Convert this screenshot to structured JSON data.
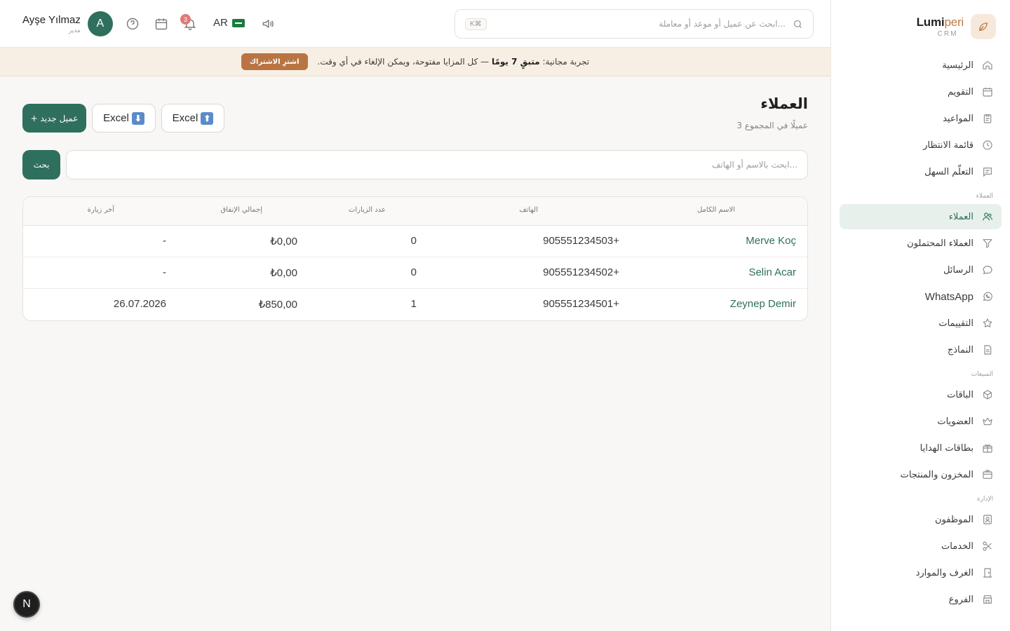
{
  "brand": {
    "name_main": "Lumi",
    "name_accent": "peri",
    "sub": "CRM",
    "accent_color": "#c17a45"
  },
  "theme": {
    "primary": "#2f6f5e",
    "banner_bg": "#f7efe4",
    "subscribe": "#b97443"
  },
  "sidebar": {
    "items_top": [
      {
        "label": "الرئيسية",
        "icon": "home-icon"
      },
      {
        "label": "التقويم",
        "icon": "calendar-icon"
      },
      {
        "label": "المواعيد",
        "icon": "clipboard-icon"
      },
      {
        "label": "قائمة الانتظار",
        "icon": "clock-icon"
      },
      {
        "label": "التعلّم السهل",
        "icon": "chat-icon"
      }
    ],
    "section_customers": "العملاء",
    "items_customers": [
      {
        "label": "العملاء",
        "icon": "users-icon",
        "active": true
      },
      {
        "label": "العملاء المحتملون",
        "icon": "filter-icon"
      },
      {
        "label": "الرسائل",
        "icon": "message-icon"
      },
      {
        "label": "WhatsApp",
        "icon": "whatsapp-icon"
      },
      {
        "label": "التقييمات",
        "icon": "star-icon"
      },
      {
        "label": "النماذج",
        "icon": "document-icon"
      }
    ],
    "section_sales": "المبيعات",
    "items_sales": [
      {
        "label": "الباقات",
        "icon": "box-icon"
      },
      {
        "label": "العضويات",
        "icon": "crown-icon"
      },
      {
        "label": "بطاقات الهدايا",
        "icon": "gift-icon"
      },
      {
        "label": "المخزون والمنتجات",
        "icon": "inventory-icon"
      }
    ],
    "section_admin": "الإدارة",
    "items_admin": [
      {
        "label": "الموظفون",
        "icon": "staff-icon"
      },
      {
        "label": "الخدمات",
        "icon": "scissors-icon"
      },
      {
        "label": "الغرف والموارد",
        "icon": "door-icon"
      },
      {
        "label": "الفروع",
        "icon": "store-icon"
      }
    ]
  },
  "topbar": {
    "search_placeholder": "ابحث عن عميل أو موعد أو معاملة...",
    "shortcut": "K⌘",
    "user_name": "Ayşe Yılmaz",
    "user_role": "مدير",
    "avatar_letter": "A",
    "notif_count": "3",
    "lang": "AR"
  },
  "banner": {
    "prefix": "تجربة مجانية: ",
    "highlight": "متبقٍ 7 يومًا",
    "suffix": " — كل المزايا مفتوحة، ويمكن الإلغاء في أي وقت.",
    "button": "اشترِ الاشتراك"
  },
  "page": {
    "title": "العملاء",
    "subtitle": "3 عميلًا في المجموع",
    "new_button": "+ عميل جديد",
    "export_label": "Excel",
    "import_label": "Excel",
    "search_placeholder": "ابحث بالاسم أو الهاتف...",
    "search_button": "بحث"
  },
  "table": {
    "headers": [
      "الاسم الكامل",
      "الهاتف",
      "عدد الزيارات",
      "إجمالي الإنفاق",
      "آخر زيارة"
    ],
    "rows": [
      {
        "name": "Merve Koç",
        "phone": "905551234503+",
        "visits": "0",
        "spend": "₺0,00",
        "last": "-"
      },
      {
        "name": "Selin Acar",
        "phone": "905551234502+",
        "visits": "0",
        "spend": "₺0,00",
        "last": "-"
      },
      {
        "name": "Zeynep Demir",
        "phone": "905551234501+",
        "visits": "1",
        "spend": "₺850,00",
        "last": "26.07.2026"
      }
    ]
  },
  "fab_letter": "N"
}
